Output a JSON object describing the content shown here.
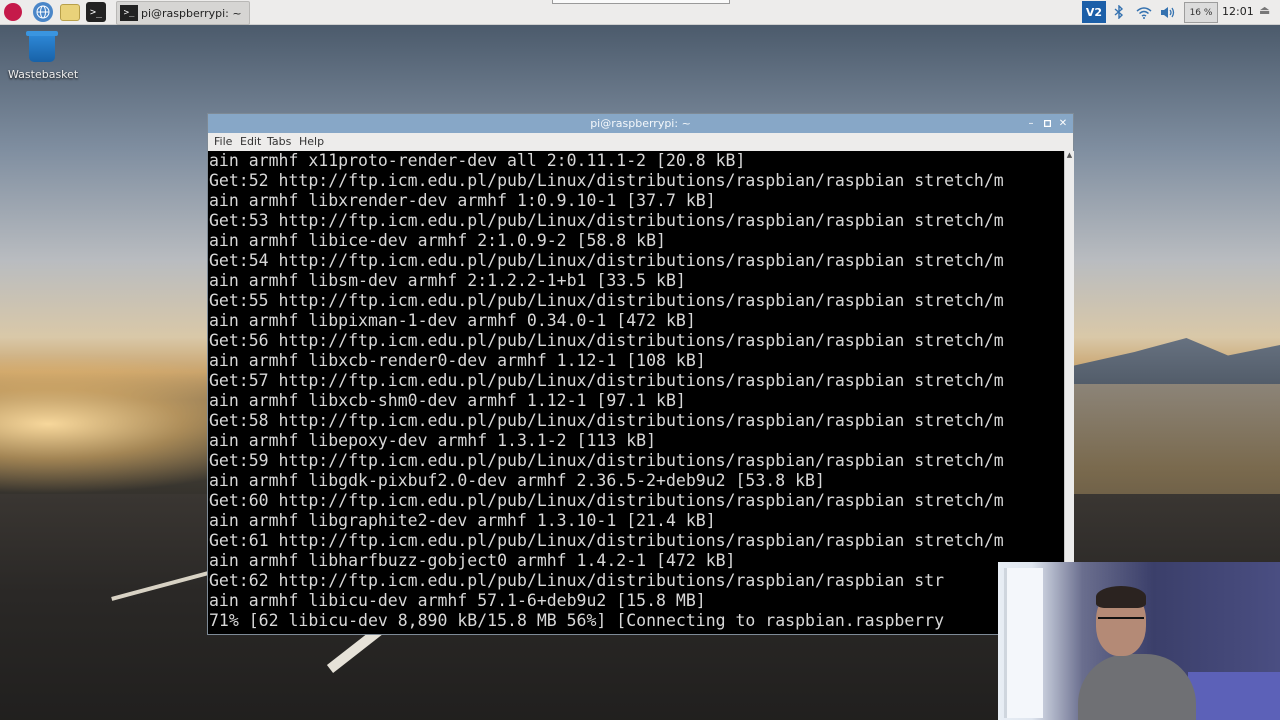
{
  "taskbar": {
    "launchers": [
      {
        "name": "raspberry-menu-icon"
      },
      {
        "name": "web-browser-icon"
      },
      {
        "name": "file-manager-icon"
      },
      {
        "name": "terminal-icon",
        "glyph": ">_"
      }
    ],
    "task_button": {
      "label": "pi@raspberrypi: ~",
      "glyph": ">_"
    },
    "tray": {
      "vnc": "V2",
      "cpu": "16 %",
      "clock": "12:01"
    }
  },
  "desktop": {
    "icons": [
      {
        "label": "Wastebasket"
      }
    ]
  },
  "terminal": {
    "title": "pi@raspberrypi: ~",
    "menu": [
      "File",
      "Edit",
      "Tabs",
      "Help"
    ],
    "lines": [
      "ain armhf x11proto-render-dev all 2:0.11.1-2 [20.8 kB]",
      "Get:52 http://ftp.icm.edu.pl/pub/Linux/distributions/raspbian/raspbian stretch/m",
      "ain armhf libxrender-dev armhf 1:0.9.10-1 [37.7 kB]",
      "Get:53 http://ftp.icm.edu.pl/pub/Linux/distributions/raspbian/raspbian stretch/m",
      "ain armhf libice-dev armhf 2:1.0.9-2 [58.8 kB]",
      "Get:54 http://ftp.icm.edu.pl/pub/Linux/distributions/raspbian/raspbian stretch/m",
      "ain armhf libsm-dev armhf 2:1.2.2-1+b1 [33.5 kB]",
      "Get:55 http://ftp.icm.edu.pl/pub/Linux/distributions/raspbian/raspbian stretch/m",
      "ain armhf libpixman-1-dev armhf 0.34.0-1 [472 kB]",
      "Get:56 http://ftp.icm.edu.pl/pub/Linux/distributions/raspbian/raspbian stretch/m",
      "ain armhf libxcb-render0-dev armhf 1.12-1 [108 kB]",
      "Get:57 http://ftp.icm.edu.pl/pub/Linux/distributions/raspbian/raspbian stretch/m",
      "ain armhf libxcb-shm0-dev armhf 1.12-1 [97.1 kB]",
      "Get:58 http://ftp.icm.edu.pl/pub/Linux/distributions/raspbian/raspbian stretch/m",
      "ain armhf libepoxy-dev armhf 1.3.1-2 [113 kB]",
      "Get:59 http://ftp.icm.edu.pl/pub/Linux/distributions/raspbian/raspbian stretch/m",
      "ain armhf libgdk-pixbuf2.0-dev armhf 2.36.5-2+deb9u2 [53.8 kB]",
      "Get:60 http://ftp.icm.edu.pl/pub/Linux/distributions/raspbian/raspbian stretch/m",
      "ain armhf libgraphite2-dev armhf 1.3.10-1 [21.4 kB]",
      "Get:61 http://ftp.icm.edu.pl/pub/Linux/distributions/raspbian/raspbian stretch/m",
      "ain armhf libharfbuzz-gobject0 armhf 1.4.2-1 [472 kB]",
      "Get:62 http://ftp.icm.edu.pl/pub/Linux/distributions/raspbian/raspbian str",
      "ain armhf libicu-dev armhf 57.1-6+deb9u2 [15.8 MB]",
      "71% [62 libicu-dev 8,890 kB/15.8 MB 56%] [Connecting to raspbian.raspberry"
    ]
  },
  "colors": {
    "titlebar": "#87a7c7",
    "terminal_bg": "#000000",
    "terminal_fg": "#d8d8d8",
    "vnc_blue": "#1c5fa8"
  }
}
